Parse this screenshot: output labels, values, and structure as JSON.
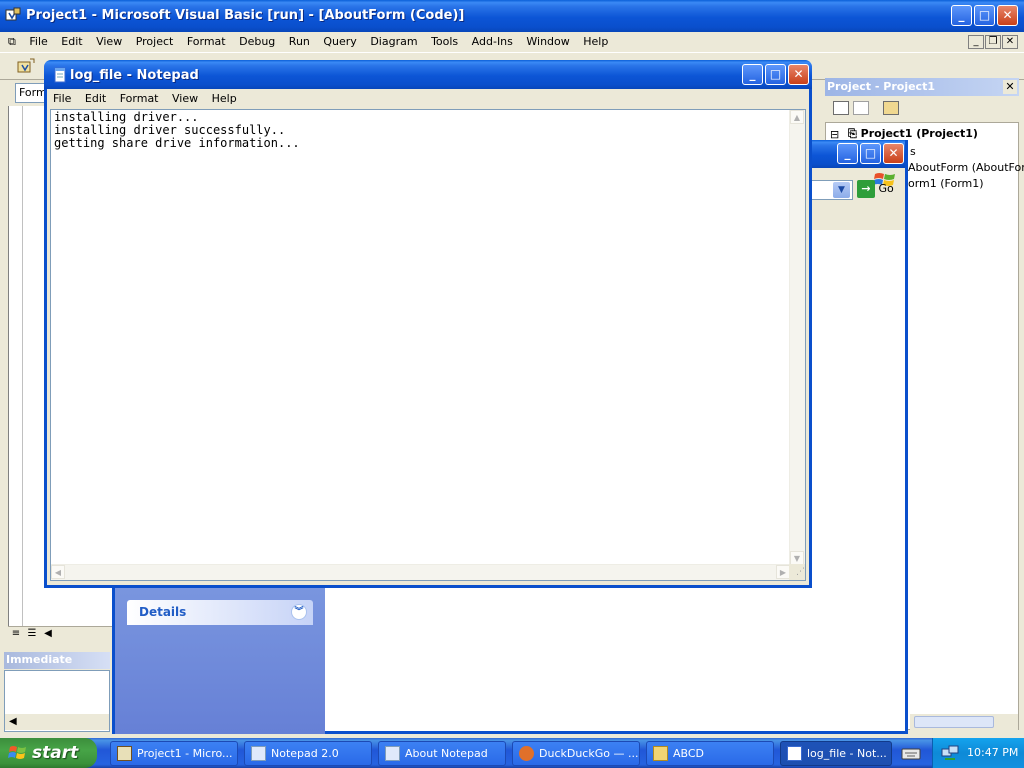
{
  "vb": {
    "title": "Project1 - Microsoft Visual Basic [run] - [AboutForm (Code)]",
    "menu": [
      "File",
      "Edit",
      "View",
      "Project",
      "Format",
      "Debug",
      "Run",
      "Query",
      "Diagram",
      "Tools",
      "Add-Ins",
      "Window",
      "Help"
    ],
    "object_combo": "Form",
    "immediate_title": "Immediate"
  },
  "project_explorer": {
    "title": "Project - Project1",
    "tree": [
      "Project1 (Project1)",
      "s",
      "AboutForm (AboutForm",
      "orm1 (Form1)"
    ]
  },
  "about_window": {
    "go_label": "Go",
    "details_label": "Details"
  },
  "notepad": {
    "title": "log_file - Notepad",
    "menu": [
      "File",
      "Edit",
      "Format",
      "View",
      "Help"
    ],
    "content": "installing driver...\ninstalling driver successfully..\ngetting share drive information..."
  },
  "taskbar": {
    "start_label": "start",
    "tasks": [
      {
        "label": "Project1 - Micro..."
      },
      {
        "label": "Notepad 2.0"
      },
      {
        "label": "About Notepad"
      },
      {
        "label": "DuckDuckGo — ..."
      },
      {
        "label": "ABCD"
      },
      {
        "label": "log_file - Not..."
      }
    ],
    "clock": "10:47 PM"
  },
  "colors": {
    "title_blue": "#0a4fcc",
    "taskbar_blue": "#2157d7",
    "start_green": "#3c8e3c",
    "taskpane_blue": "#7a96df"
  }
}
